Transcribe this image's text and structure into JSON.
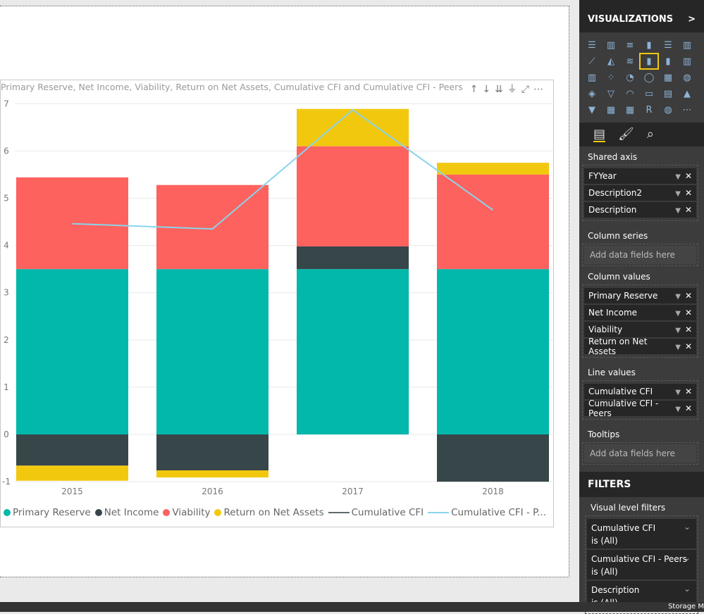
{
  "visual": {
    "title": "Primary Reserve, Net Income, Viability, Return on Net Assets, Cumulative CFI and Cumulative CFI - Peers",
    "toolbar_icons": [
      "drill-up-icon",
      "drill-down-icon",
      "expand-all-icon",
      "hierarchy-icon",
      "focus-mode-icon",
      "more-options-icon"
    ]
  },
  "chart_data": {
    "type": "bar",
    "stacked": true,
    "title": "Primary Reserve, Net Income, Viability, Return on Net Assets, Cumulative CFI and Cumulative CFI - Peers",
    "categories": [
      "2015",
      "2016",
      "2017",
      "2018"
    ],
    "ylim": [
      -1,
      7
    ],
    "yticks": [
      "-1",
      "0",
      "1",
      "2",
      "3",
      "4",
      "5",
      "6",
      "7"
    ],
    "grid": true,
    "legend": "bottom",
    "series": [
      {
        "name": "Primary Reserve",
        "type": "bar",
        "color": "#01b8aa",
        "values": [
          3.5,
          3.5,
          3.5,
          3.5
        ]
      },
      {
        "name": "Net Income",
        "type": "bar",
        "color": "#374649",
        "values": [
          -0.66,
          -0.76,
          0.48,
          -1.0
        ]
      },
      {
        "name": "Viability",
        "type": "bar",
        "color": "#fd625e",
        "values": [
          1.94,
          1.78,
          2.12,
          2.0
        ]
      },
      {
        "name": "Return on Net Assets",
        "type": "bar",
        "color": "#f2c80f",
        "values": [
          -0.32,
          -0.15,
          0.79,
          0.25
        ]
      },
      {
        "name": "Cumulative CFI",
        "type": "line",
        "color": "#5f6b6d",
        "values": [
          null,
          null,
          null,
          null
        ]
      },
      {
        "name": "Cumulative CFI - Peers",
        "type": "line",
        "color": "#8ad4eb",
        "values": [
          4.46,
          4.35,
          6.87,
          4.75
        ]
      }
    ],
    "legend_labels": [
      "Primary Reserve",
      "Net Income",
      "Viability",
      "Return on Net Assets",
      "Cumulative CFI",
      "Cumulative CFI - P..."
    ]
  },
  "side": {
    "viz_header": "VISUALIZATIONS",
    "viz_chevron": ">",
    "viz_icons": [
      "stacked-bar",
      "stacked-column",
      "clustered-bar",
      "clustered-column",
      "100-bar",
      "100-column",
      "line",
      "area",
      "stacked-area",
      "line-stacked-column",
      "line-clustered-column",
      "ribbon",
      "waterfall",
      "scatter",
      "pie",
      "donut",
      "treemap",
      "map",
      "filled-map",
      "funnel",
      "gauge",
      "card",
      "multi-row-card",
      "kpi",
      "slicer",
      "table",
      "matrix",
      "r-script",
      "globe",
      "more"
    ],
    "viz_selected": 9,
    "sections": {
      "shared_axis": "Shared axis",
      "column_series": "Column series",
      "column_values": "Column values",
      "line_values": "Line values",
      "tooltips": "Tooltips"
    },
    "shared_axis": [
      "FYYear",
      "Description2",
      "Description"
    ],
    "column_values": [
      "Primary Reserve",
      "Net Income",
      "Viability",
      "Return on Net Assets"
    ],
    "line_values": [
      "Cumulative CFI",
      "Cumulative CFI - Peers"
    ],
    "placeholder": "Add data fields here",
    "filters_header": "FILTERS",
    "visual_level": "Visual level filters",
    "filters": [
      {
        "name": "Cumulative CFI",
        "state": "is (All)"
      },
      {
        "name": "Cumulative CFI - Peers",
        "state": "is (All)"
      },
      {
        "name": "Description",
        "state": "is (All)"
      }
    ]
  },
  "status": {
    "storage": "Storage M"
  }
}
